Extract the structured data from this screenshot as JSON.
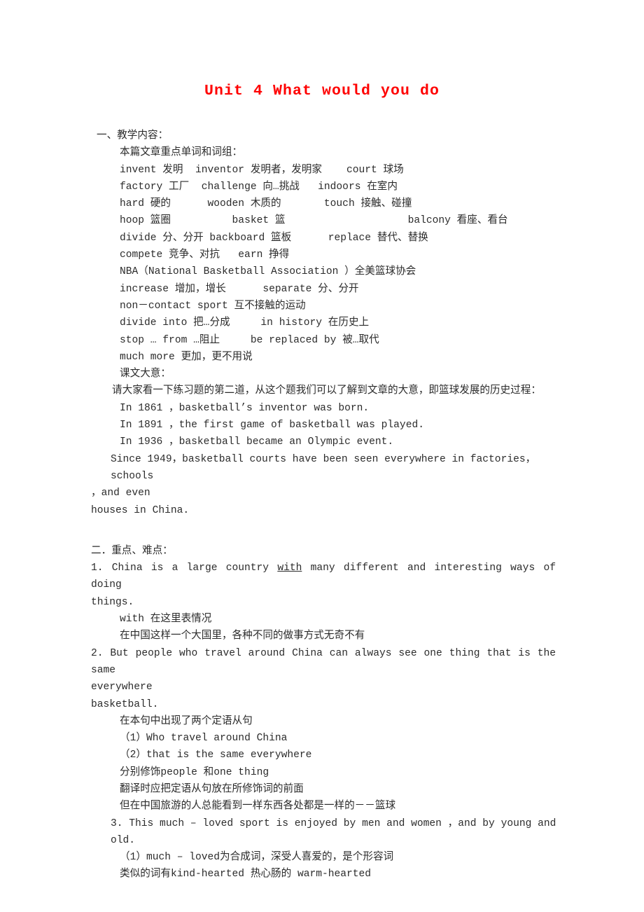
{
  "document": {
    "title": "Unit 4 What would you do",
    "title_color": "#ff0000"
  },
  "section1": {
    "heading": "一、教学内容：",
    "subheading": "本篇文章重点单词和词组：",
    "vocab_lines": [
      "invent 发明  inventor 发明者，发明家    court 球场",
      "factory 工厂  challenge 向…挑战   indoors 在室内",
      "hard 硬的      wooden 木质的       touch 接触、碰撞",
      "hoop 篮圈          basket 篮                    balcony 看座、看台",
      "divide 分、分开 backboard 篮板      replace 替代、替换",
      "compete 竞争、对抗   earn 挣得",
      "NBA（National Basketball Association ）全美篮球协会",
      "increase 增加，增长      separate 分、分开",
      "non－contact sport 互不接触的运动",
      "divide into 把…分成     in history 在历史上",
      "stop … from …阻止     be replaced by 被…取代",
      "much more 更加，更不用说"
    ],
    "gist_label": "课文大意：",
    "gist_paragraph": "请大家看一下练习题的第二道，从这个题我们可以了解到文章的大意，即篮球发展的历史过程：",
    "timeline": [
      "In 1861 ，basketball’s inventor was born.",
      "In 1891 ，the first game of basketball was played.",
      "In 1936 ，basketball became an Olympic event.",
      "Since 1949，basketball courts have been seen everywhere in factories，schools"
    ],
    "timeline_wrap_a": "，and even",
    "timeline_wrap_b": "houses in China."
  },
  "section2": {
    "heading": "二．重点、难点：",
    "item1": {
      "number": "1.",
      "text_before": " China is a large country ",
      "underlined": "with",
      "text_after": " many different and interesting ways of doing",
      "wrap": "things.",
      "notes": [
        "with 在这里表情况",
        "在中国这样一个大国里，各种不同的做事方式无奇不有"
      ]
    },
    "item2": {
      "number": "2.",
      "text": " But people who travel around China can always see one thing that is the same",
      "wrap_a": "everywhere",
      "wrap_b": "basketball.",
      "notes": [
        "在本句中出现了两个定语从句",
        "（1）Who travel around China",
        "（2）that is the same everywhere",
        "分别修饰people 和one thing",
        "翻译时应把定语从句放在所修饰词的前面",
        "但在中国旅游的人总能看到一样东西各处都是一样的－－篮球"
      ]
    },
    "item3": {
      "number": "3.",
      "text": " This much – loved sport is enjoyed by men and women ，and by young and old.",
      "notes": [
        "（1）much – loved为合成词，深受人喜爱的，是个形容词",
        "类似的词有kind-hearted 热心肠的 warm-hearted"
      ]
    }
  }
}
